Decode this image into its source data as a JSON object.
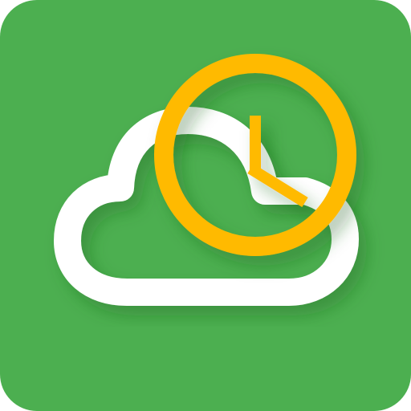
{
  "icon": {
    "name": "cloud-clock-app-icon",
    "tile_color": "#4CAF50",
    "cloud_color": "#FFFFFF",
    "clock_color": "#FFBA00",
    "shadow_color": "#1B5E20",
    "clock_time": {
      "hour_hand_angle_deg": 0,
      "minute_hand_angle_deg": 122
    }
  }
}
